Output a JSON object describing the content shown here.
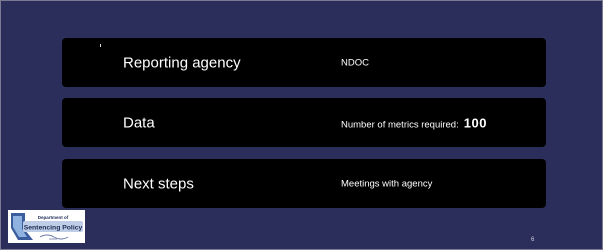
{
  "rows": [
    {
      "label": "Reporting agency",
      "value": "NDOC"
    },
    {
      "label": "Data",
      "value": "Number of metrics required:",
      "number": "100"
    },
    {
      "label": "Next steps",
      "value": "Meetings with agency"
    }
  ],
  "logo": {
    "line1": "Department of",
    "line2": "Sentencing Policy"
  },
  "page_number": "6",
  "colors": {
    "background": "#2b2e5b",
    "panel": "#000000",
    "text": "#ffffff"
  }
}
